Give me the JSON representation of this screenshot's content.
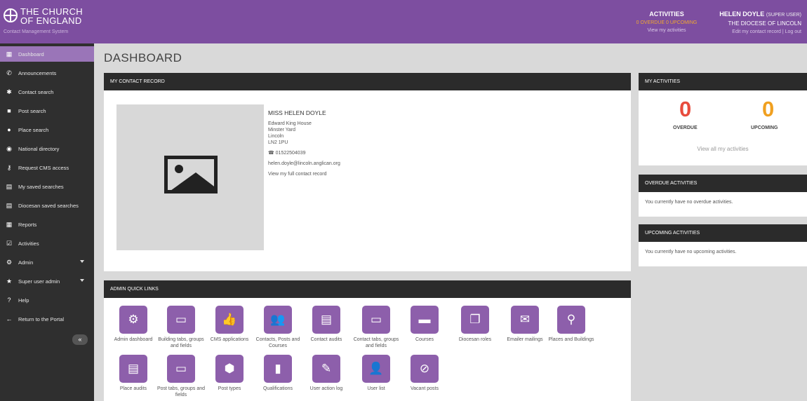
{
  "header": {
    "logo_line1": "THE CHURCH",
    "logo_line2": "OF ENGLAND",
    "logo_sub": "Contact Management System",
    "activities_title": "ACTIVITIES",
    "activities_counts": "0 OVERDUE  0 UPCOMING",
    "activities_link": "View my activities",
    "user_name": "HELEN DOYLE",
    "user_role": "(SUPER USER)",
    "user_diocese": "THE DIOCESE OF LINCOLN",
    "user_links": "Edit my contact record | Log out"
  },
  "sidebar": {
    "items": [
      {
        "label": "Dashboard",
        "icon": "▦"
      },
      {
        "label": "Announcements",
        "icon": "✆"
      },
      {
        "label": "Contact search",
        "icon": "✱"
      },
      {
        "label": "Post search",
        "icon": "■"
      },
      {
        "label": "Place search",
        "icon": "●"
      },
      {
        "label": "National directory",
        "icon": "◉"
      },
      {
        "label": "Request CMS access",
        "icon": "⚷"
      },
      {
        "label": "My saved searches",
        "icon": "▤"
      },
      {
        "label": "Diocesan saved searches",
        "icon": "▤"
      },
      {
        "label": "Reports",
        "icon": "▦"
      },
      {
        "label": "Activities",
        "icon": "☑"
      },
      {
        "label": "Admin",
        "icon": "⚙"
      },
      {
        "label": "Super user admin",
        "icon": "★"
      },
      {
        "label": "Help",
        "icon": "?"
      },
      {
        "label": "Return to the Portal",
        "icon": "←"
      }
    ],
    "collapse": "«"
  },
  "main": {
    "title": "DASHBOARD",
    "contact_panel_title": "MY CONTACT RECORD",
    "contact": {
      "name": "MISS HELEN DOYLE",
      "address": [
        "Edward King House",
        "Minster Yard",
        "Lincoln",
        "LN2 1PU"
      ],
      "phone": "☎ 01522504039",
      "email": "helen.doyle@lincoln.anglican.org",
      "view_link": "View my full contact record"
    },
    "quicklinks_title": "ADMIN QUICK LINKS",
    "tiles": [
      {
        "label": "Admin dashboard",
        "icon": "⚙"
      },
      {
        "label": "Building tabs, groups and fields",
        "icon": "▭"
      },
      {
        "label": "CMS applications",
        "icon": "👍"
      },
      {
        "label": "Contacts, Posts and Courses",
        "icon": "👥"
      },
      {
        "label": "Contact audits",
        "icon": "▤"
      },
      {
        "label": "Contact tabs, groups and fields",
        "icon": "▭"
      },
      {
        "label": "Courses",
        "icon": "▬"
      },
      {
        "label": "Diocesan roles",
        "icon": "❐"
      },
      {
        "label": "Emailer mailings",
        "icon": "✉"
      },
      {
        "label": "Places and Buildings",
        "icon": "⚲"
      },
      {
        "label": "Place audits",
        "icon": "▤"
      },
      {
        "label": "Post tabs, groups and fields",
        "icon": "▭"
      },
      {
        "label": "Post types",
        "icon": "⬢"
      },
      {
        "label": "Qualifications",
        "icon": "▮"
      },
      {
        "label": "User action log",
        "icon": "✎"
      },
      {
        "label": "User list",
        "icon": "👤"
      },
      {
        "label": "Vacant posts",
        "icon": "⊘"
      }
    ]
  },
  "right": {
    "activities_title": "MY ACTIVITIES",
    "overdue_count": "0",
    "overdue_label": "OVERDUE",
    "upcoming_count": "0",
    "upcoming_label": "UPCOMING",
    "view_all": "View all my activities",
    "overdue_title": "OVERDUE ACTIVITIES",
    "overdue_text": "You currently have no overdue activities.",
    "upcoming_title": "UPCOMING ACTIVITIES",
    "upcoming_text": "You currently have no upcoming activities."
  },
  "colors": {
    "brand_purple": "#7d4ea0",
    "tile_purple": "#8d5fab",
    "overdue_red": "#e84c3d",
    "upcoming_orange": "#f0a020"
  }
}
